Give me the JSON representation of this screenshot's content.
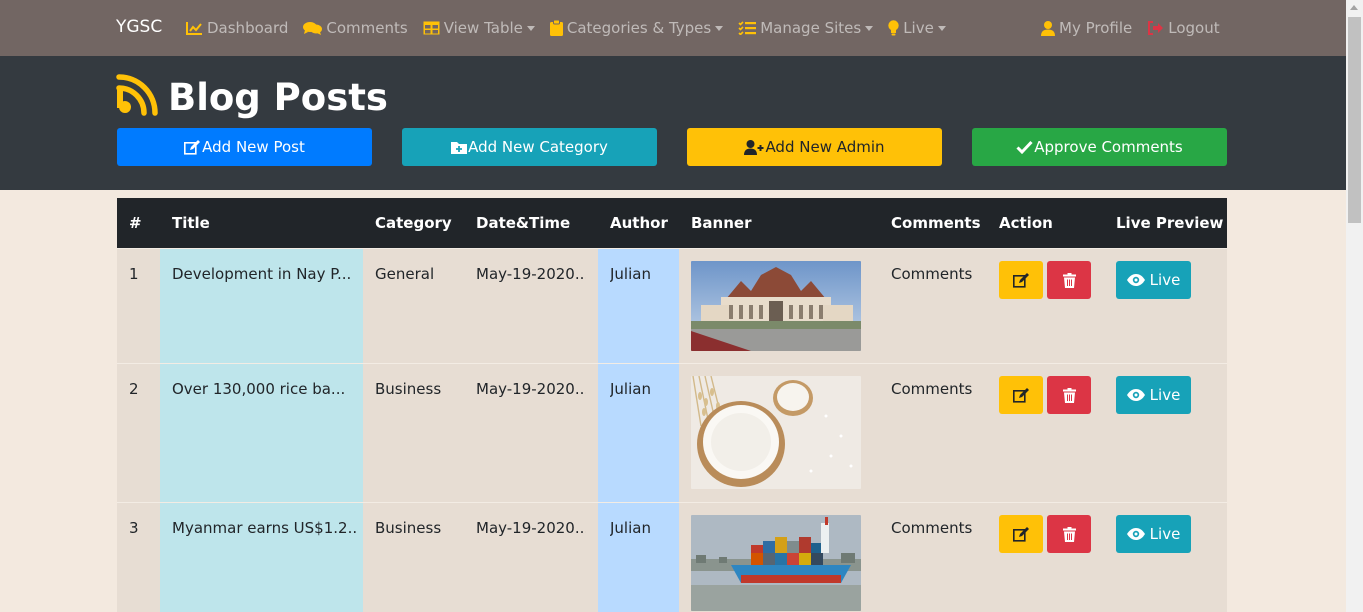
{
  "nav": {
    "brand": "YGSC",
    "items": [
      {
        "label": "Dashboard",
        "icon": "chart-line-icon",
        "dropdown": false
      },
      {
        "label": "Comments",
        "icon": "comments-icon",
        "dropdown": false
      },
      {
        "label": "View Table",
        "icon": "table-icon",
        "dropdown": true
      },
      {
        "label": "Categories & Types",
        "icon": "clipboard-icon",
        "dropdown": true
      },
      {
        "label": "Manage Sites",
        "icon": "tasks-icon",
        "dropdown": true
      },
      {
        "label": "Live",
        "icon": "lightbulb-icon",
        "dropdown": true
      }
    ],
    "profile": "My Profile",
    "logout": "Logout"
  },
  "header": {
    "title": "Blog Posts",
    "buttons": {
      "add_post": "Add New Post",
      "add_category": "Add New Category",
      "add_admin": "Add New Admin",
      "approve_comments": "Approve Comments"
    }
  },
  "table": {
    "columns": [
      "#",
      "Title",
      "Category",
      "Date&Time",
      "Author",
      "Banner",
      "Comments",
      "Action",
      "Live Preview"
    ],
    "rows": [
      {
        "num": "1",
        "title": "Development in Nay P...",
        "category": "General",
        "datetime": "May-19-2020...",
        "author": "Julian",
        "banner": "government-building-image",
        "comments": "Comments",
        "live": "Live"
      },
      {
        "num": "2",
        "title": "Over 130,000 rice ba...",
        "category": "Business",
        "datetime": "May-19-2020...",
        "author": "Julian",
        "banner": "rice-bowl-image",
        "comments": "Comments",
        "live": "Live"
      },
      {
        "num": "3",
        "title": "Myanmar earns US$1.2...",
        "category": "Business",
        "datetime": "May-19-2020...",
        "author": "Julian",
        "banner": "cargo-ship-image",
        "comments": "Comments",
        "live": "Live"
      }
    ]
  },
  "colors": {
    "navbar": "#726663",
    "header": "#343a40",
    "accent": "#ffc107",
    "primary": "#007bff",
    "info": "#17a2b8",
    "success": "#28a745",
    "danger": "#dc3545"
  }
}
